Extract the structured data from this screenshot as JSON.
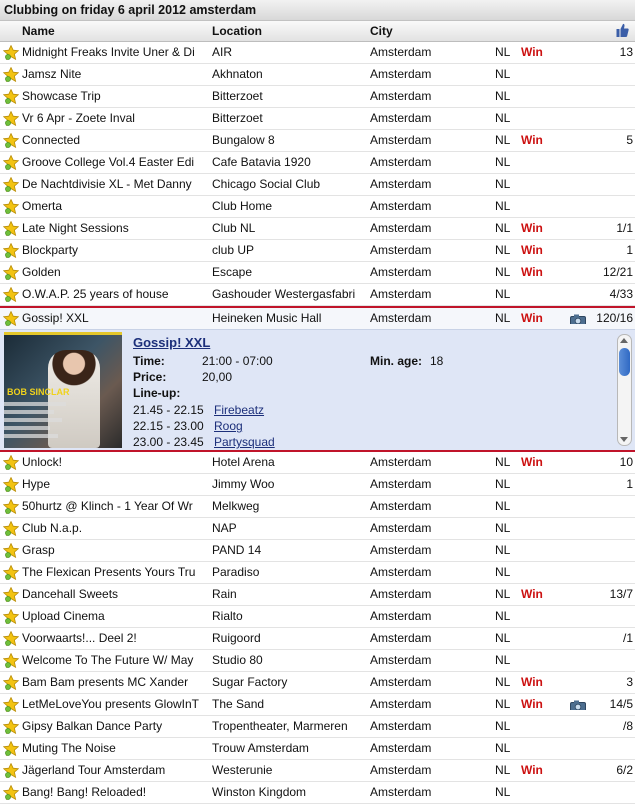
{
  "title": "Clubbing on friday 6 april 2012 amsterdam",
  "columns": {
    "name": "Name",
    "location": "Location",
    "city": "City"
  },
  "win_label": "Win",
  "rows_top": [
    {
      "name": "Midnight Freaks Invite Uner & Di",
      "location": "AIR",
      "city": "Amsterdam",
      "cc": "NL",
      "win": true,
      "count": "13"
    },
    {
      "name": "Jamsz Nite",
      "location": "Akhnaton",
      "city": "Amsterdam",
      "cc": "NL",
      "win": false,
      "count": ""
    },
    {
      "name": "Showcase Trip",
      "location": "Bitterzoet",
      "city": "Amsterdam",
      "cc": "NL",
      "win": false,
      "count": ""
    },
    {
      "name": "Vr 6 Apr - Zoete Inval",
      "location": "Bitterzoet",
      "city": "Amsterdam",
      "cc": "NL",
      "win": false,
      "count": ""
    },
    {
      "name": "Connected",
      "location": "Bungalow 8",
      "city": "Amsterdam",
      "cc": "NL",
      "win": true,
      "count": "5"
    },
    {
      "name": "Groove College Vol.4 Easter Edi",
      "location": "Cafe Batavia 1920",
      "city": "Amsterdam",
      "cc": "NL",
      "win": false,
      "count": ""
    },
    {
      "name": "De Nachtdivisie XL - Met Danny",
      "location": "Chicago Social Club",
      "city": "Amsterdam",
      "cc": "NL",
      "win": false,
      "count": ""
    },
    {
      "name": "Omerta",
      "location": "Club Home",
      "city": "Amsterdam",
      "cc": "NL",
      "win": false,
      "count": ""
    },
    {
      "name": "Late Night Sessions",
      "location": "Club NL",
      "city": "Amsterdam",
      "cc": "NL",
      "win": true,
      "count": "1/1"
    },
    {
      "name": "Blockparty",
      "location": "club UP",
      "city": "Amsterdam",
      "cc": "NL",
      "win": true,
      "count": "1"
    },
    {
      "name": "Golden",
      "location": "Escape",
      "city": "Amsterdam",
      "cc": "NL",
      "win": true,
      "count": "12/21"
    },
    {
      "name": "O.W.A.P. 25 years of house",
      "location": "Gashouder Westergasfabri",
      "city": "Amsterdam",
      "cc": "NL",
      "win": false,
      "count": "4/33"
    }
  ],
  "selected": {
    "name": "Gossip! XXL",
    "location": "Heineken Music Hall",
    "city": "Amsterdam",
    "cc": "NL",
    "win": true,
    "camera": true,
    "count": "120/16",
    "detail": {
      "title": "Gossip! XXL",
      "time_label": "Time:",
      "time": "21:00 - 07:00",
      "minage_label": "Min. age:",
      "minage": "18",
      "price_label": "Price:",
      "price": "20,00",
      "lineup_label": "Line-up:",
      "lineup": [
        {
          "time": "21.45 - 22.15",
          "artist": "Firebeatz"
        },
        {
          "time": "22.15 - 23.00",
          "artist": "Roog"
        },
        {
          "time": "23.00 - 23.45",
          "artist": "Partysquad"
        }
      ]
    }
  },
  "rows_bottom": [
    {
      "name": "Unlock!",
      "location": "Hotel Arena",
      "city": "Amsterdam",
      "cc": "NL",
      "win": true,
      "camera": false,
      "count": "10"
    },
    {
      "name": "Hype",
      "location": "Jimmy Woo",
      "city": "Amsterdam",
      "cc": "NL",
      "win": false,
      "camera": false,
      "count": "1"
    },
    {
      "name": "50hurtz @ Klinch - 1 Year Of Wr",
      "location": "Melkweg",
      "city": "Amsterdam",
      "cc": "NL",
      "win": false,
      "camera": false,
      "count": ""
    },
    {
      "name": "Club N.a.p.",
      "location": "NAP",
      "city": "Amsterdam",
      "cc": "NL",
      "win": false,
      "camera": false,
      "count": ""
    },
    {
      "name": "Grasp",
      "location": "PAND 14",
      "city": "Amsterdam",
      "cc": "NL",
      "win": false,
      "camera": false,
      "count": ""
    },
    {
      "name": "The Flexican Presents Yours Tru",
      "location": "Paradiso",
      "city": "Amsterdam",
      "cc": "NL",
      "win": false,
      "camera": false,
      "count": ""
    },
    {
      "name": "Dancehall Sweets",
      "location": "Rain",
      "city": "Amsterdam",
      "cc": "NL",
      "win": true,
      "camera": false,
      "count": "13/7"
    },
    {
      "name": "Upload Cinema",
      "location": "Rialto",
      "city": "Amsterdam",
      "cc": "NL",
      "win": false,
      "camera": false,
      "count": ""
    },
    {
      "name": "Voorwaarts!... Deel 2!",
      "location": "Ruigoord",
      "city": "Amsterdam",
      "cc": "NL",
      "win": false,
      "camera": false,
      "count": "/1"
    },
    {
      "name": "Welcome To The Future W/ May",
      "location": "Studio 80",
      "city": "Amsterdam",
      "cc": "NL",
      "win": false,
      "camera": false,
      "count": ""
    },
    {
      "name": "Bam Bam presents MC Xander",
      "location": "Sugar Factory",
      "city": "Amsterdam",
      "cc": "NL",
      "win": true,
      "camera": false,
      "count": "3"
    },
    {
      "name": "LetMeLoveYou presents GlowInT",
      "location": "The Sand",
      "city": "Amsterdam",
      "cc": "NL",
      "win": true,
      "camera": true,
      "count": "14/5"
    },
    {
      "name": "Gipsy Balkan Dance Party",
      "location": "Tropentheater, Marmeren",
      "city": "Amsterdam",
      "cc": "NL",
      "win": false,
      "camera": false,
      "count": "/8"
    },
    {
      "name": "Muting The Noise",
      "location": "Trouw Amsterdam",
      "city": "Amsterdam",
      "cc": "NL",
      "win": false,
      "camera": false,
      "count": ""
    },
    {
      "name": "Jägerland Tour Amsterdam",
      "location": "Westerunie",
      "city": "Amsterdam",
      "cc": "NL",
      "win": true,
      "camera": false,
      "count": "6/2"
    },
    {
      "name": "Bang! Bang! Reloaded!",
      "location": "Winston Kingdom",
      "city": "Amsterdam",
      "cc": "NL",
      "win": false,
      "camera": false,
      "count": ""
    }
  ],
  "poster": {
    "headliner": "BOB SINCLAR"
  },
  "colors": {
    "win": "#cc1111",
    "selection_border": "#c0142a",
    "detail_bg": "#dfe6f6",
    "link": "#1c2f7a",
    "star": "#f2c312"
  }
}
